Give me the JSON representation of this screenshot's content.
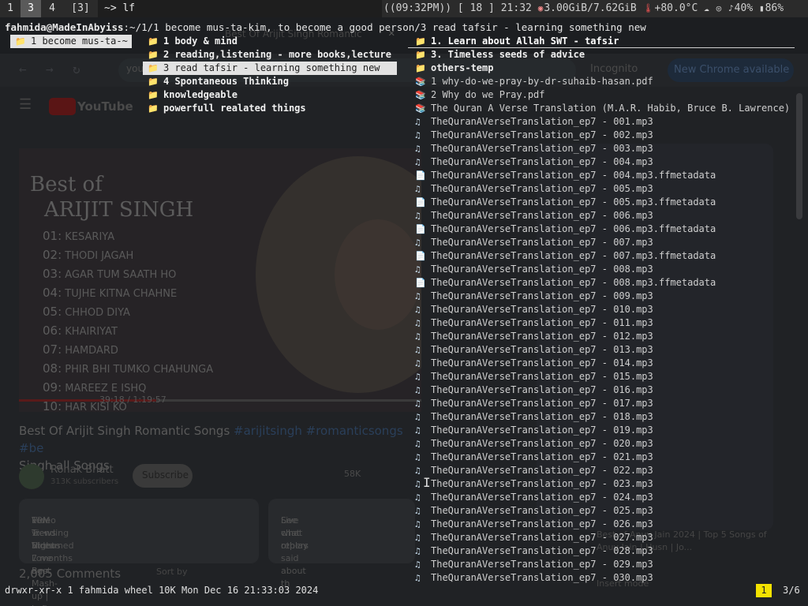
{
  "bar": {
    "workspaces": [
      {
        "label": "1",
        "active": false
      },
      {
        "label": "3",
        "active": true
      },
      {
        "label": "4",
        "active": false
      },
      {
        "label": "[3]",
        "active": false
      }
    ],
    "title": "~> lf",
    "uptime": "((09:32PM))",
    "volume_bracket": "[ 18 ]",
    "clock": "21:32",
    "memory": "3.00GiB/7.62GiB",
    "temperature": "+80.0°C",
    "volume": "40%",
    "battery": "86%"
  },
  "background": {
    "tab_title": "Best Of Arijit Singh Romantic",
    "url": "you",
    "incognito": "Incognito",
    "chrome_button": "New Chrome available",
    "youtube": "YouTube",
    "video_title_line1": "Best of",
    "video_title_line2": "ARIJIT SINGH",
    "songs": [
      {
        "num": "01:",
        "name": "KESARIYA"
      },
      {
        "num": "02:",
        "name": "THODI JAGAH"
      },
      {
        "num": "03:",
        "name": "AGAR TUM SAATH HO"
      },
      {
        "num": "04:",
        "name": "TUJHE KITNA CHAHNE"
      },
      {
        "num": "05:",
        "name": "CHHOD DIYA"
      },
      {
        "num": "06:",
        "name": "KHAIRIYAT"
      },
      {
        "num": "07:",
        "name": "HAMDARD"
      },
      {
        "num": "08:",
        "name": "PHIR BHI TUMKO CHAHUNGA"
      },
      {
        "num": "09:",
        "name": "MAREEZ E ISHQ"
      },
      {
        "num": "10:",
        "name": "HAR KISI KO"
      }
    ],
    "time": "39:18 / 1:19:57",
    "page_title": "Best Of Arijit Singh Romantic Songs ",
    "page_title_tags": "#arijitsingh #romanticsongs #be",
    "page_title_line2": "Singh all Songs",
    "channel": "Ronak Bhatt",
    "subscribers": "313K subscribers",
    "subscribe": "Subscribe",
    "likes": "58K",
    "views": "10M views  Streamed 7 months ago",
    "desc_line": "Few Trending Videos",
    "desc_line2": "Video 1: • Night Love Best Mash-up | Lofi ...more",
    "live_chat": "Live chat replay",
    "live_chat_sub": "See what others said about th",
    "comments": "2,005 Comments",
    "sort_by": "Sort by",
    "side_card": "Best of Anuv Jain 2024 | Top 5 Songs of Anuv Jain | Husn | Jo...",
    "side_card2": "Insert mode"
  },
  "terminal": {
    "prompt_user": "fahmida@MadeInAbyiss",
    "prompt_path": ":~/1/1 become mus-ta-kim, to become a good person/3 read tafsir - learning something new",
    "parent": [
      {
        "name": "1 become mus-ta-~",
        "type": "dir",
        "selected": true
      }
    ],
    "current": [
      {
        "name": "1 body & mind",
        "type": "dir",
        "selected": false
      },
      {
        "name": "2 reading,listening - more books,lecture",
        "type": "dir",
        "selected": false
      },
      {
        "name": "3 read tafsir - learning something new",
        "type": "dir",
        "selected": true
      },
      {
        "name": "4 Spontaneous Thinking",
        "type": "dir",
        "selected": false
      },
      {
        "name": "knowledgeable",
        "type": "dir",
        "selected": false
      },
      {
        "name": "powerfull realated things",
        "type": "dir",
        "selected": false
      }
    ],
    "preview": [
      {
        "name": "1. Learn about Allah SWT - tafsir",
        "type": "dir",
        "cursor": true
      },
      {
        "name": "3. Timeless seeds of advice",
        "type": "dir"
      },
      {
        "name": "others-temp",
        "type": "dir"
      },
      {
        "name": "1 why-do-we-pray-by-dr-suhaib-hasan.pdf",
        "type": "pdf"
      },
      {
        "name": "2 Why do we Pray.pdf",
        "type": "pdf"
      },
      {
        "name": "The Quran A Verse Translation (M.A.R. Habib, Bruce B. Lawrence) ~",
        "type": "pdf"
      },
      {
        "name": "TheQuranAVerseTranslation_ep7 - 001.mp3",
        "type": "mp3"
      },
      {
        "name": "TheQuranAVerseTranslation_ep7 - 002.mp3",
        "type": "mp3"
      },
      {
        "name": "TheQuranAVerseTranslation_ep7 - 003.mp3",
        "type": "mp3"
      },
      {
        "name": "TheQuranAVerseTranslation_ep7 - 004.mp3",
        "type": "mp3"
      },
      {
        "name": "TheQuranAVerseTranslation_ep7 - 004.mp3.ffmetadata",
        "type": "meta"
      },
      {
        "name": "TheQuranAVerseTranslation_ep7 - 005.mp3",
        "type": "mp3"
      },
      {
        "name": "TheQuranAVerseTranslation_ep7 - 005.mp3.ffmetadata",
        "type": "meta"
      },
      {
        "name": "TheQuranAVerseTranslation_ep7 - 006.mp3",
        "type": "mp3"
      },
      {
        "name": "TheQuranAVerseTranslation_ep7 - 006.mp3.ffmetadata",
        "type": "meta"
      },
      {
        "name": "TheQuranAVerseTranslation_ep7 - 007.mp3",
        "type": "mp3"
      },
      {
        "name": "TheQuranAVerseTranslation_ep7 - 007.mp3.ffmetadata",
        "type": "meta"
      },
      {
        "name": "TheQuranAVerseTranslation_ep7 - 008.mp3",
        "type": "mp3"
      },
      {
        "name": "TheQuranAVerseTranslation_ep7 - 008.mp3.ffmetadata",
        "type": "meta"
      },
      {
        "name": "TheQuranAVerseTranslation_ep7 - 009.mp3",
        "type": "mp3"
      },
      {
        "name": "TheQuranAVerseTranslation_ep7 - 010.mp3",
        "type": "mp3"
      },
      {
        "name": "TheQuranAVerseTranslation_ep7 - 011.mp3",
        "type": "mp3"
      },
      {
        "name": "TheQuranAVerseTranslation_ep7 - 012.mp3",
        "type": "mp3"
      },
      {
        "name": "TheQuranAVerseTranslation_ep7 - 013.mp3",
        "type": "mp3"
      },
      {
        "name": "TheQuranAVerseTranslation_ep7 - 014.mp3",
        "type": "mp3"
      },
      {
        "name": "TheQuranAVerseTranslation_ep7 - 015.mp3",
        "type": "mp3"
      },
      {
        "name": "TheQuranAVerseTranslation_ep7 - 016.mp3",
        "type": "mp3"
      },
      {
        "name": "TheQuranAVerseTranslation_ep7 - 017.mp3",
        "type": "mp3"
      },
      {
        "name": "TheQuranAVerseTranslation_ep7 - 018.mp3",
        "type": "mp3"
      },
      {
        "name": "TheQuranAVerseTranslation_ep7 - 019.mp3",
        "type": "mp3"
      },
      {
        "name": "TheQuranAVerseTranslation_ep7 - 020.mp3",
        "type": "mp3"
      },
      {
        "name": "TheQuranAVerseTranslation_ep7 - 021.mp3",
        "type": "mp3"
      },
      {
        "name": "TheQuranAVerseTranslation_ep7 - 022.mp3",
        "type": "mp3"
      },
      {
        "name": "TheQuranAVerseTranslation_ep7 - 023.mp3",
        "type": "mp3"
      },
      {
        "name": "TheQuranAVerseTranslation_ep7 - 024.mp3",
        "type": "mp3"
      },
      {
        "name": "TheQuranAVerseTranslation_ep7 - 025.mp3",
        "type": "mp3"
      },
      {
        "name": "TheQuranAVerseTranslation_ep7 - 026.mp3",
        "type": "mp3"
      },
      {
        "name": "TheQuranAVerseTranslation_ep7 - 027.mp3",
        "type": "mp3"
      },
      {
        "name": "TheQuranAVerseTranslation_ep7 - 028.mp3",
        "type": "mp3"
      },
      {
        "name": "TheQuranAVerseTranslation_ep7 - 029.mp3",
        "type": "mp3"
      },
      {
        "name": "TheQuranAVerseTranslation_ep7 - 030.mp3",
        "type": "mp3"
      }
    ],
    "status_line": "drwxr-xr-x 1 fahmida wheel 10K Mon Dec 16 21:33:03 2024",
    "selection_count": "1",
    "position": "3/6"
  }
}
